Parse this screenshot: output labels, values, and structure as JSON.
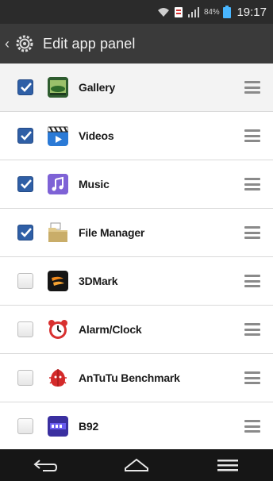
{
  "status_bar": {
    "battery_percent": "84%",
    "time": "19:17",
    "icons": [
      "wifi-icon",
      "notification-icon",
      "signal-icon",
      "battery-icon"
    ]
  },
  "header": {
    "title": "Edit app panel",
    "back_icon": "back-chevron-icon",
    "settings_icon": "gear-icon"
  },
  "apps": [
    {
      "label": "Gallery",
      "checked": true,
      "icon": "gallery-icon"
    },
    {
      "label": "Videos",
      "checked": true,
      "icon": "videos-icon"
    },
    {
      "label": "Music",
      "checked": true,
      "icon": "music-icon"
    },
    {
      "label": "File Manager",
      "checked": true,
      "icon": "file-manager-icon"
    },
    {
      "label": "3DMark",
      "checked": false,
      "icon": "3dmark-icon"
    },
    {
      "label": "Alarm/Clock",
      "checked": false,
      "icon": "alarm-clock-icon"
    },
    {
      "label": "AnTuTu Benchmark",
      "checked": false,
      "icon": "antutu-icon"
    },
    {
      "label": "B92",
      "checked": false,
      "icon": "b92-icon"
    }
  ],
  "nav_bar": {
    "buttons": [
      "back-icon",
      "home-icon",
      "menu-icon"
    ]
  },
  "colors": {
    "checkbox_checked": "#2f5fa6",
    "title_bar": "#3a3a3a",
    "status_bar": "#2b2b2b",
    "nav_bar": "#161616"
  }
}
